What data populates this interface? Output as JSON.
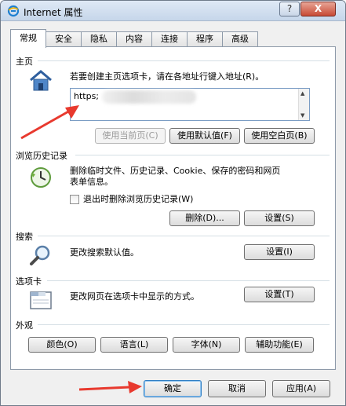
{
  "window": {
    "title": "Internet 属性",
    "help_label": "?",
    "close_label": "X"
  },
  "tabs": [
    "常规",
    "安全",
    "隐私",
    "内容",
    "连接",
    "程序",
    "高级"
  ],
  "homepage": {
    "label": "主页",
    "description": "若要创建主页选项卡，请在各地址行键入地址(R)。",
    "url_value": "https;",
    "use_current_label": "使用当前页(C)",
    "use_default_label": "使用默认值(F)",
    "use_blank_label": "使用空白页(B)"
  },
  "history": {
    "label": "浏览历史记录",
    "description_line1": "删除临时文件、历史记录、Cookie、保存的密码和网页",
    "description_line2": "表单信息。",
    "checkbox_label": "退出时删除浏览历史记录(W)",
    "delete_label": "删除(D)...",
    "settings_label": "设置(S)"
  },
  "search": {
    "label": "搜索",
    "description": "更改搜索默认值。",
    "settings_label": "设置(I)"
  },
  "tabs_section": {
    "label": "选项卡",
    "description": "更改网页在选项卡中显示的方式。",
    "settings_label": "设置(T)"
  },
  "appearance": {
    "label": "外观",
    "colors_label": "颜色(O)",
    "languages_label": "语言(L)",
    "fonts_label": "字体(N)",
    "accessibility_label": "辅助功能(E)"
  },
  "footer": {
    "ok_label": "确定",
    "cancel_label": "取消",
    "apply_label": "应用(A)"
  },
  "colors": {
    "annotation_arrow": "#e8392e",
    "default_button_border": "#2f7ec4"
  }
}
